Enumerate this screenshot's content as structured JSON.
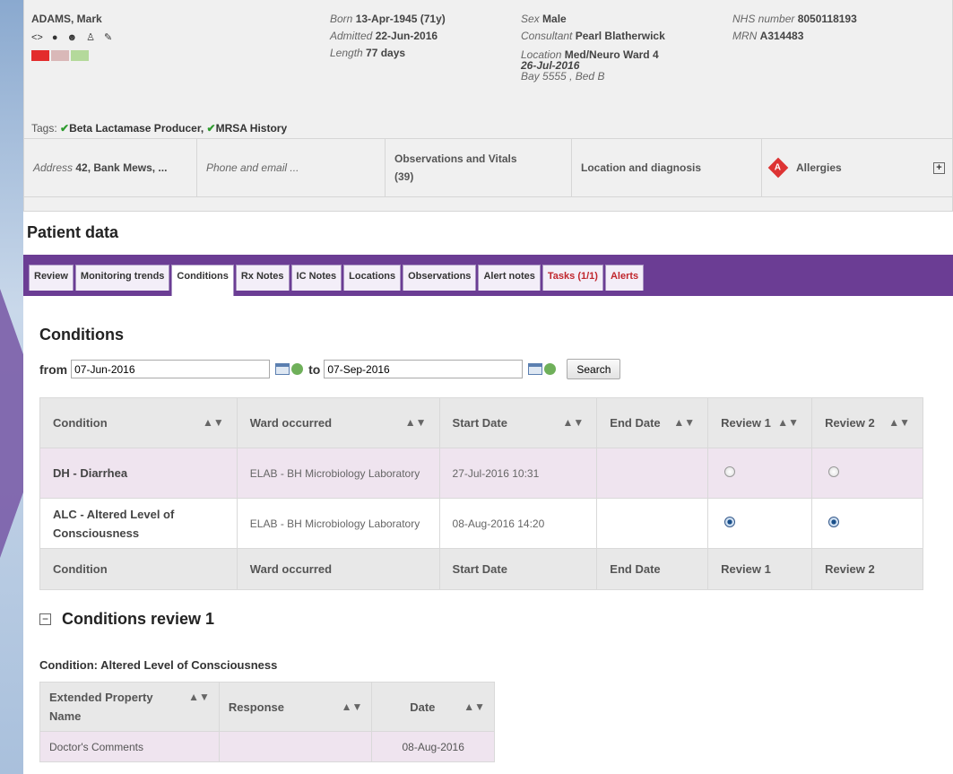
{
  "banner": {
    "name": "ADAMS, Mark",
    "born_label": "Born",
    "born_value": "13-Apr-1945 (71y)",
    "admitted_label": "Admitted",
    "admitted_value": "22-Jun-2016",
    "length_label": "Length",
    "length_value": "77 days",
    "sex_label": "Sex",
    "sex_value": "Male",
    "consultant_label": "Consultant",
    "consultant_value": "Pearl Blatherwick",
    "location_label": "Location",
    "location_value": "Med/Neuro Ward 4",
    "location_date": "26-Jul-2016",
    "bay_label": "Bay",
    "bay_value": "5555",
    "bed_label": "Bed",
    "bed_value": "B",
    "nhs_label": "NHS number",
    "nhs_value": "8050118193",
    "mrn_label": "MRN",
    "mrn_value": "A314483",
    "status_colors": [
      "#e32c2c",
      "#d9b8b8",
      "#b4d99b"
    ],
    "tags_label": "Tags:",
    "tags": [
      "Beta Lactamase Producer,",
      "MRSA History"
    ]
  },
  "summary": {
    "address_label": "Address",
    "address_value": "42, Bank Mews, ...",
    "phone_label": "Phone and email ...",
    "observations": "Observations and Vitals (39)",
    "location_diag": "Location and diagnosis",
    "allergies": "Allergies",
    "allergy_badge": "A"
  },
  "patient_data_title": "Patient data",
  "tabs": [
    {
      "label": "Review"
    },
    {
      "label": "Monitoring trends"
    },
    {
      "label": "Conditions"
    },
    {
      "label": "Rx Notes"
    },
    {
      "label": "IC Notes"
    },
    {
      "label": "Locations"
    },
    {
      "label": "Observations"
    },
    {
      "label": "Alert notes"
    },
    {
      "label": "Tasks (1/1)"
    },
    {
      "label": "Alerts"
    }
  ],
  "conditions": {
    "title": "Conditions",
    "from_label": "from",
    "from_value": "07-Jun-2016",
    "to_label": "to",
    "to_value": "07-Sep-2016",
    "search_label": "Search",
    "columns": [
      "Condition",
      "Ward occurred",
      "Start Date",
      "End Date",
      "Review 1",
      "Review 2"
    ],
    "rows": [
      {
        "condition": "DH - Diarrhea",
        "ward": "ELAB - BH Microbiology Laboratory",
        "start": "27-Jul-2016 10:31",
        "end": "",
        "review1": false,
        "review2": false
      },
      {
        "condition": "ALC - Altered Level of Consciousness",
        "ward": "ELAB - BH Microbiology Laboratory",
        "start": "08-Aug-2016 14:20",
        "end": "",
        "review1": true,
        "review2": true
      }
    ]
  },
  "review": {
    "title": "Conditions review 1",
    "condition_line": "Condition: Altered Level of Consciousness",
    "columns": [
      "Extended Property Name",
      "Response",
      "Date"
    ],
    "rows": [
      {
        "name": "Doctor's Comments",
        "response": "",
        "date": "08-Aug-2016"
      }
    ]
  }
}
